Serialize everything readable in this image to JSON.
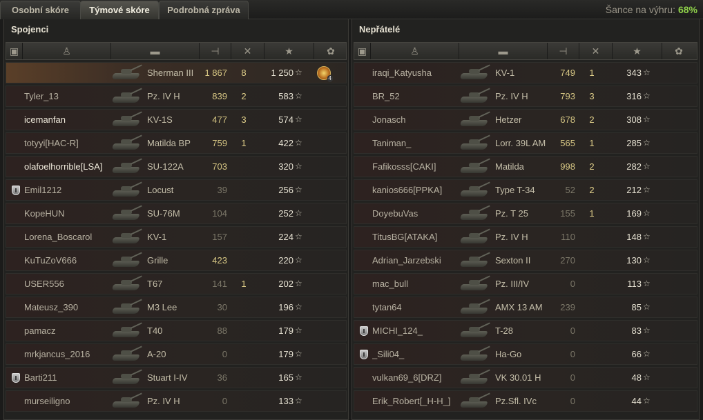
{
  "tabs": [
    "Osobní skóre",
    "Týmové skóre",
    "Podrobná zpráva"
  ],
  "active_tab": 1,
  "chance": {
    "label": "Šance na výhru:",
    "value": "68%"
  },
  "header_icons": [
    "platoon-icon",
    "player-icon",
    "vehicle-icon",
    "damage-icon",
    "kills-icon",
    "xp-star-icon",
    "achievement-icon"
  ],
  "teams": {
    "allies": {
      "title": "Spojenci",
      "rows": [
        {
          "name": "",
          "tank": "Sherman III",
          "dmg": "1 867",
          "kills": "8",
          "xp": "1 250",
          "star": "☆",
          "medal": "4",
          "highlight": true
        },
        {
          "name": "Tyler_13",
          "tank": "Pz. IV H",
          "dmg": "839",
          "kills": "2",
          "xp": "583",
          "star": "☆"
        },
        {
          "name": "icemanfan",
          "tank": "KV-1S",
          "dmg": "477",
          "kills": "3",
          "xp": "574",
          "star": "☆",
          "bright": true
        },
        {
          "name": "totyyi[HAC-R]",
          "tank": "Matilda BP",
          "dmg": "759",
          "kills": "1",
          "xp": "422",
          "star": "☆"
        },
        {
          "name": "olafoelhorrible[LSA]",
          "tank": "SU-122A",
          "dmg": "703",
          "kills": "",
          "xp": "320",
          "star": "☆",
          "bright": true
        },
        {
          "name": "Emil1212",
          "tank": "Locust",
          "dmg": "39",
          "kills": "",
          "xp": "256",
          "star": "☆",
          "platoon": true
        },
        {
          "name": "KopeHUN",
          "tank": "SU-76M",
          "dmg": "104",
          "kills": "",
          "xp": "252",
          "star": "☆"
        },
        {
          "name": "Lorena_Boscarol",
          "tank": "KV-1",
          "dmg": "157",
          "kills": "",
          "xp": "224",
          "star": "☆"
        },
        {
          "name": "KuTuZoV666",
          "tank": "Grille",
          "dmg": "423",
          "kills": "",
          "xp": "220",
          "star": "☆"
        },
        {
          "name": "USER556",
          "tank": "T67",
          "dmg": "141",
          "kills": "1",
          "xp": "202",
          "star": "☆"
        },
        {
          "name": "Mateusz_390",
          "tank": "M3 Lee",
          "dmg": "30",
          "kills": "",
          "xp": "196",
          "star": "☆"
        },
        {
          "name": "pamacz",
          "tank": "T40",
          "dmg": "88",
          "kills": "",
          "xp": "179",
          "star": "☆"
        },
        {
          "name": "mrkjancus_2016",
          "tank": "A-20",
          "dmg": "0",
          "kills": "",
          "xp": "179",
          "star": "☆"
        },
        {
          "name": "Barti211",
          "tank": "Stuart I-IV",
          "dmg": "36",
          "kills": "",
          "xp": "165",
          "star": "☆",
          "platoon": true
        },
        {
          "name": "murseiligno",
          "tank": "Pz. IV H",
          "dmg": "0",
          "kills": "",
          "xp": "133",
          "star": "☆"
        }
      ]
    },
    "enemies": {
      "title": "Nepřátelé",
      "rows": [
        {
          "name": "iraqi_Katyusha",
          "tank": "KV-1",
          "dmg": "749",
          "kills": "1",
          "xp": "343",
          "star": "☆"
        },
        {
          "name": "BR_52",
          "tank": "Pz. IV H",
          "dmg": "793",
          "kills": "3",
          "xp": "316",
          "star": "☆"
        },
        {
          "name": "Jonasch",
          "tank": "Hetzer",
          "dmg": "678",
          "kills": "2",
          "xp": "308",
          "star": "☆"
        },
        {
          "name": "Taniman_",
          "tank": "Lorr. 39L AM",
          "dmg": "565",
          "kills": "1",
          "xp": "285",
          "star": "☆"
        },
        {
          "name": "Fafikosss[CAKI]",
          "tank": "Matilda",
          "dmg": "998",
          "kills": "2",
          "xp": "282",
          "star": "☆"
        },
        {
          "name": "kanios666[PPKA]",
          "tank": "Type T-34",
          "dmg": "52",
          "kills": "2",
          "xp": "212",
          "star": "☆"
        },
        {
          "name": "DoyebuVas",
          "tank": "Pz. T 25",
          "dmg": "155",
          "kills": "1",
          "xp": "169",
          "star": "☆"
        },
        {
          "name": "TitusBG[ATAKA]",
          "tank": "Pz. IV H",
          "dmg": "110",
          "kills": "",
          "xp": "148",
          "star": "☆"
        },
        {
          "name": "Adrian_Jarzebski",
          "tank": "Sexton II",
          "dmg": "270",
          "kills": "",
          "xp": "130",
          "star": "☆"
        },
        {
          "name": "mac_bull",
          "tank": "Pz. III/IV",
          "dmg": "0",
          "kills": "",
          "xp": "113",
          "star": "☆"
        },
        {
          "name": "tytan64",
          "tank": "AMX 13 AM",
          "dmg": "239",
          "kills": "",
          "xp": "85",
          "star": "☆"
        },
        {
          "name": "MICHI_124_",
          "tank": "T-28",
          "dmg": "0",
          "kills": "",
          "xp": "83",
          "star": "☆",
          "platoon": true
        },
        {
          "name": "_Sili04_",
          "tank": "Ha-Go",
          "dmg": "0",
          "kills": "",
          "xp": "66",
          "star": "☆",
          "platoon": true
        },
        {
          "name": "vulkan69_6[DRZ]",
          "tank": "VK 30.01 H",
          "dmg": "0",
          "kills": "",
          "xp": "48",
          "star": "☆"
        },
        {
          "name": "Erik_Robert[_H-H_]",
          "tank": "Pz.Sfl. IVc",
          "dmg": "0",
          "kills": "",
          "xp": "44",
          "star": "☆"
        }
      ]
    }
  }
}
